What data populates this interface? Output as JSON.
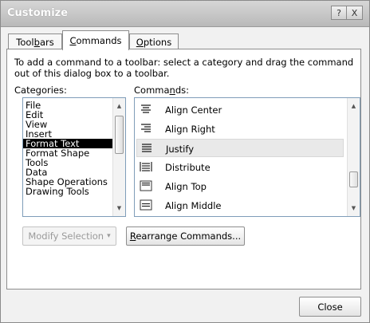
{
  "window": {
    "title": "Customize",
    "help_glyph": "?",
    "close_glyph": "X"
  },
  "tabs": [
    {
      "label_pre": "Tool",
      "label_u": "b",
      "label_post": "ars",
      "active": false
    },
    {
      "label_pre": "",
      "label_u": "C",
      "label_post": "ommands",
      "active": true
    },
    {
      "label_pre": "",
      "label_u": "O",
      "label_post": "ptions",
      "active": false
    }
  ],
  "instructions": "To add a command to a toolbar: select a category and drag the command out of this dialog box to a toolbar.",
  "categories_label": "Categories:",
  "commands_label": {
    "pre": "Comma",
    "u": "n",
    "post": "ds:"
  },
  "categories": [
    {
      "label": "File",
      "selected": false
    },
    {
      "label": "Edit",
      "selected": false
    },
    {
      "label": "View",
      "selected": false
    },
    {
      "label": "Insert",
      "selected": false
    },
    {
      "label": "Format Text",
      "selected": true
    },
    {
      "label": "Format Shape",
      "selected": false
    },
    {
      "label": "Tools",
      "selected": false
    },
    {
      "label": "Data",
      "selected": false
    },
    {
      "label": "Shape Operations",
      "selected": false
    },
    {
      "label": "Drawing Tools",
      "selected": false
    }
  ],
  "commands": [
    {
      "label": "Align Center",
      "icon": "align-center-icon",
      "selected": false
    },
    {
      "label": "Align Right",
      "icon": "align-right-icon",
      "selected": false
    },
    {
      "label": "Justify",
      "icon": "justify-icon",
      "selected": true
    },
    {
      "label": "Distribute",
      "icon": "distribute-icon",
      "selected": false
    },
    {
      "label": "Align Top",
      "icon": "align-top-icon",
      "selected": false
    },
    {
      "label": "Align Middle",
      "icon": "align-middle-icon",
      "selected": false
    }
  ],
  "buttons": {
    "modify_selection": "Modify Selection",
    "modify_selection_arrow": "▾",
    "rearrange": {
      "pre": "",
      "u": "R",
      "post": "earrange Commands..."
    },
    "close": "Close"
  }
}
